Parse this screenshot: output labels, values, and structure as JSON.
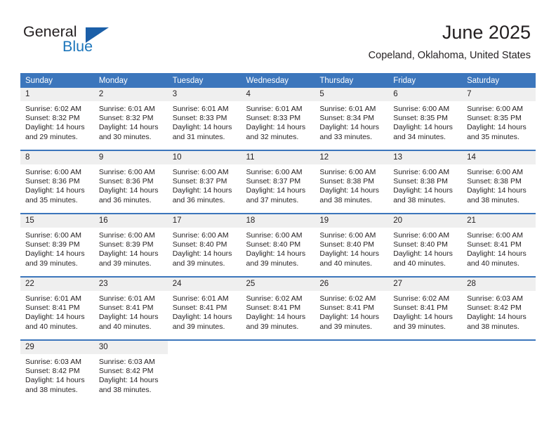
{
  "logo": {
    "word_one": "General",
    "word_two": "Blue",
    "triangle": "blue-triangle-icon"
  },
  "header": {
    "title": "June 2025",
    "location": "Copeland, Oklahoma, United States"
  },
  "colors": {
    "header_blue": "#3c76bc",
    "logo_blue": "#1b75bb",
    "daynum_gray": "#efefef",
    "text": "#231f20"
  },
  "weekday_headers": [
    "Sunday",
    "Monday",
    "Tuesday",
    "Wednesday",
    "Thursday",
    "Friday",
    "Saturday"
  ],
  "weeks": [
    [
      {
        "day": "1",
        "sunrise": "Sunrise: 6:02 AM",
        "sunset": "Sunset: 8:32 PM",
        "daylight_line1": "Daylight: 14 hours",
        "daylight_line2": "and 29 minutes."
      },
      {
        "day": "2",
        "sunrise": "Sunrise: 6:01 AM",
        "sunset": "Sunset: 8:32 PM",
        "daylight_line1": "Daylight: 14 hours",
        "daylight_line2": "and 30 minutes."
      },
      {
        "day": "3",
        "sunrise": "Sunrise: 6:01 AM",
        "sunset": "Sunset: 8:33 PM",
        "daylight_line1": "Daylight: 14 hours",
        "daylight_line2": "and 31 minutes."
      },
      {
        "day": "4",
        "sunrise": "Sunrise: 6:01 AM",
        "sunset": "Sunset: 8:33 PM",
        "daylight_line1": "Daylight: 14 hours",
        "daylight_line2": "and 32 minutes."
      },
      {
        "day": "5",
        "sunrise": "Sunrise: 6:01 AM",
        "sunset": "Sunset: 8:34 PM",
        "daylight_line1": "Daylight: 14 hours",
        "daylight_line2": "and 33 minutes."
      },
      {
        "day": "6",
        "sunrise": "Sunrise: 6:00 AM",
        "sunset": "Sunset: 8:35 PM",
        "daylight_line1": "Daylight: 14 hours",
        "daylight_line2": "and 34 minutes."
      },
      {
        "day": "7",
        "sunrise": "Sunrise: 6:00 AM",
        "sunset": "Sunset: 8:35 PM",
        "daylight_line1": "Daylight: 14 hours",
        "daylight_line2": "and 35 minutes."
      }
    ],
    [
      {
        "day": "8",
        "sunrise": "Sunrise: 6:00 AM",
        "sunset": "Sunset: 8:36 PM",
        "daylight_line1": "Daylight: 14 hours",
        "daylight_line2": "and 35 minutes."
      },
      {
        "day": "9",
        "sunrise": "Sunrise: 6:00 AM",
        "sunset": "Sunset: 8:36 PM",
        "daylight_line1": "Daylight: 14 hours",
        "daylight_line2": "and 36 minutes."
      },
      {
        "day": "10",
        "sunrise": "Sunrise: 6:00 AM",
        "sunset": "Sunset: 8:37 PM",
        "daylight_line1": "Daylight: 14 hours",
        "daylight_line2": "and 36 minutes."
      },
      {
        "day": "11",
        "sunrise": "Sunrise: 6:00 AM",
        "sunset": "Sunset: 8:37 PM",
        "daylight_line1": "Daylight: 14 hours",
        "daylight_line2": "and 37 minutes."
      },
      {
        "day": "12",
        "sunrise": "Sunrise: 6:00 AM",
        "sunset": "Sunset: 8:38 PM",
        "daylight_line1": "Daylight: 14 hours",
        "daylight_line2": "and 38 minutes."
      },
      {
        "day": "13",
        "sunrise": "Sunrise: 6:00 AM",
        "sunset": "Sunset: 8:38 PM",
        "daylight_line1": "Daylight: 14 hours",
        "daylight_line2": "and 38 minutes."
      },
      {
        "day": "14",
        "sunrise": "Sunrise: 6:00 AM",
        "sunset": "Sunset: 8:38 PM",
        "daylight_line1": "Daylight: 14 hours",
        "daylight_line2": "and 38 minutes."
      }
    ],
    [
      {
        "day": "15",
        "sunrise": "Sunrise: 6:00 AM",
        "sunset": "Sunset: 8:39 PM",
        "daylight_line1": "Daylight: 14 hours",
        "daylight_line2": "and 39 minutes."
      },
      {
        "day": "16",
        "sunrise": "Sunrise: 6:00 AM",
        "sunset": "Sunset: 8:39 PM",
        "daylight_line1": "Daylight: 14 hours",
        "daylight_line2": "and 39 minutes."
      },
      {
        "day": "17",
        "sunrise": "Sunrise: 6:00 AM",
        "sunset": "Sunset: 8:40 PM",
        "daylight_line1": "Daylight: 14 hours",
        "daylight_line2": "and 39 minutes."
      },
      {
        "day": "18",
        "sunrise": "Sunrise: 6:00 AM",
        "sunset": "Sunset: 8:40 PM",
        "daylight_line1": "Daylight: 14 hours",
        "daylight_line2": "and 39 minutes."
      },
      {
        "day": "19",
        "sunrise": "Sunrise: 6:00 AM",
        "sunset": "Sunset: 8:40 PM",
        "daylight_line1": "Daylight: 14 hours",
        "daylight_line2": "and 40 minutes."
      },
      {
        "day": "20",
        "sunrise": "Sunrise: 6:00 AM",
        "sunset": "Sunset: 8:40 PM",
        "daylight_line1": "Daylight: 14 hours",
        "daylight_line2": "and 40 minutes."
      },
      {
        "day": "21",
        "sunrise": "Sunrise: 6:00 AM",
        "sunset": "Sunset: 8:41 PM",
        "daylight_line1": "Daylight: 14 hours",
        "daylight_line2": "and 40 minutes."
      }
    ],
    [
      {
        "day": "22",
        "sunrise": "Sunrise: 6:01 AM",
        "sunset": "Sunset: 8:41 PM",
        "daylight_line1": "Daylight: 14 hours",
        "daylight_line2": "and 40 minutes."
      },
      {
        "day": "23",
        "sunrise": "Sunrise: 6:01 AM",
        "sunset": "Sunset: 8:41 PM",
        "daylight_line1": "Daylight: 14 hours",
        "daylight_line2": "and 40 minutes."
      },
      {
        "day": "24",
        "sunrise": "Sunrise: 6:01 AM",
        "sunset": "Sunset: 8:41 PM",
        "daylight_line1": "Daylight: 14 hours",
        "daylight_line2": "and 39 minutes."
      },
      {
        "day": "25",
        "sunrise": "Sunrise: 6:02 AM",
        "sunset": "Sunset: 8:41 PM",
        "daylight_line1": "Daylight: 14 hours",
        "daylight_line2": "and 39 minutes."
      },
      {
        "day": "26",
        "sunrise": "Sunrise: 6:02 AM",
        "sunset": "Sunset: 8:41 PM",
        "daylight_line1": "Daylight: 14 hours",
        "daylight_line2": "and 39 minutes."
      },
      {
        "day": "27",
        "sunrise": "Sunrise: 6:02 AM",
        "sunset": "Sunset: 8:41 PM",
        "daylight_line1": "Daylight: 14 hours",
        "daylight_line2": "and 39 minutes."
      },
      {
        "day": "28",
        "sunrise": "Sunrise: 6:03 AM",
        "sunset": "Sunset: 8:42 PM",
        "daylight_line1": "Daylight: 14 hours",
        "daylight_line2": "and 38 minutes."
      }
    ],
    [
      {
        "day": "29",
        "sunrise": "Sunrise: 6:03 AM",
        "sunset": "Sunset: 8:42 PM",
        "daylight_line1": "Daylight: 14 hours",
        "daylight_line2": "and 38 minutes."
      },
      {
        "day": "30",
        "sunrise": "Sunrise: 6:03 AM",
        "sunset": "Sunset: 8:42 PM",
        "daylight_line1": "Daylight: 14 hours",
        "daylight_line2": "and 38 minutes."
      },
      {
        "day": "",
        "sunrise": "",
        "sunset": "",
        "daylight_line1": "",
        "daylight_line2": ""
      },
      {
        "day": "",
        "sunrise": "",
        "sunset": "",
        "daylight_line1": "",
        "daylight_line2": ""
      },
      {
        "day": "",
        "sunrise": "",
        "sunset": "",
        "daylight_line1": "",
        "daylight_line2": ""
      },
      {
        "day": "",
        "sunrise": "",
        "sunset": "",
        "daylight_line1": "",
        "daylight_line2": ""
      },
      {
        "day": "",
        "sunrise": "",
        "sunset": "",
        "daylight_line1": "",
        "daylight_line2": ""
      }
    ]
  ]
}
